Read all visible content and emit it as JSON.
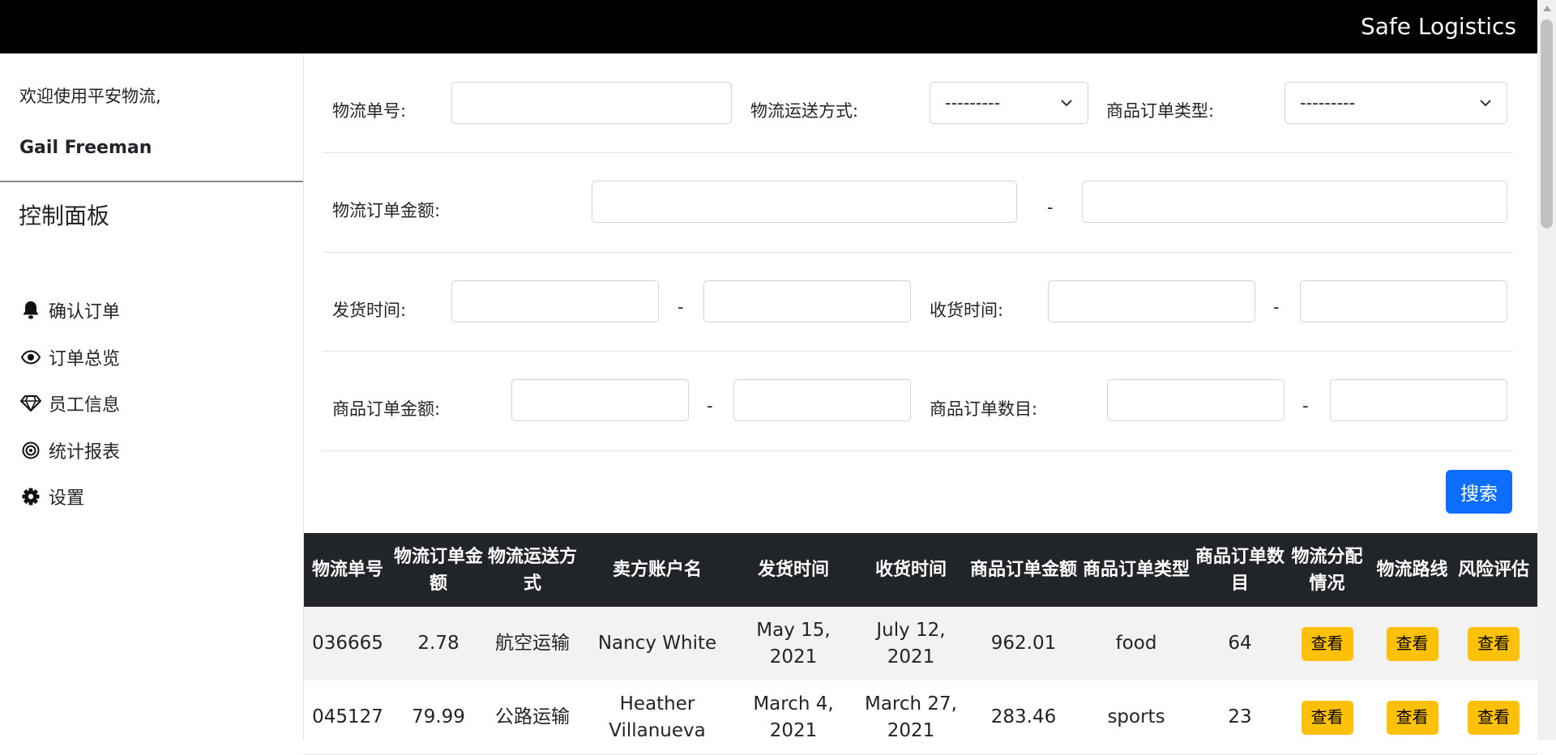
{
  "header": {
    "brand": "Safe Logistics"
  },
  "sidebar": {
    "welcome": "欢迎使用平安物流,",
    "username": "Gail Freeman",
    "panel_title": "控制面板",
    "items": [
      {
        "label": "确认订单",
        "icon": "bell-icon"
      },
      {
        "label": "订单总览",
        "icon": "eye-icon"
      },
      {
        "label": "员工信息",
        "icon": "gem-icon"
      },
      {
        "label": "统计报表",
        "icon": "target-icon"
      },
      {
        "label": "设置",
        "icon": "gear-icon"
      }
    ]
  },
  "filters": {
    "tracking_no_label": "物流单号:",
    "tracking_no_value": "",
    "shipping_method_label": "物流运送方式:",
    "shipping_method_selected": "---------",
    "order_type_label": "商品订单类型:",
    "order_type_selected": "---------",
    "logistics_amount_label": "物流订单金额:",
    "logistics_amount_min": "",
    "logistics_amount_max": "",
    "ship_time_label": "发货时间:",
    "ship_time_from": "",
    "ship_time_to": "",
    "receive_time_label": "收货时间:",
    "receive_time_from": "",
    "receive_time_to": "",
    "goods_amount_label": "商品订单金额:",
    "goods_amount_min": "",
    "goods_amount_max": "",
    "goods_count_label": "商品订单数目:",
    "goods_count_min": "",
    "goods_count_max": "",
    "range_sep": "-",
    "search_label": "搜索"
  },
  "table": {
    "headers": [
      "物流单号",
      "物流订单金额",
      "物流运送方式",
      "卖方账户名",
      "发货时间",
      "收货时间",
      "商品订单金额",
      "商品订单类型",
      "商品订单数目",
      "物流分配情况",
      "物流路线",
      "风险评估"
    ],
    "action_label": "查看",
    "rows": [
      [
        "036665",
        "2.78",
        "航空运输",
        "Nancy White",
        "May 15, 2021",
        "July 12, 2021",
        "962.01",
        "food",
        "64"
      ],
      [
        "045127",
        "79.99",
        "公路运输",
        "Heather Villanueva",
        "March 4, 2021",
        "March 27, 2021",
        "283.46",
        "sports",
        "23"
      ]
    ]
  },
  "colors": {
    "primary": "#0d6efd",
    "warning": "#ffc107",
    "dark": "#212529"
  }
}
